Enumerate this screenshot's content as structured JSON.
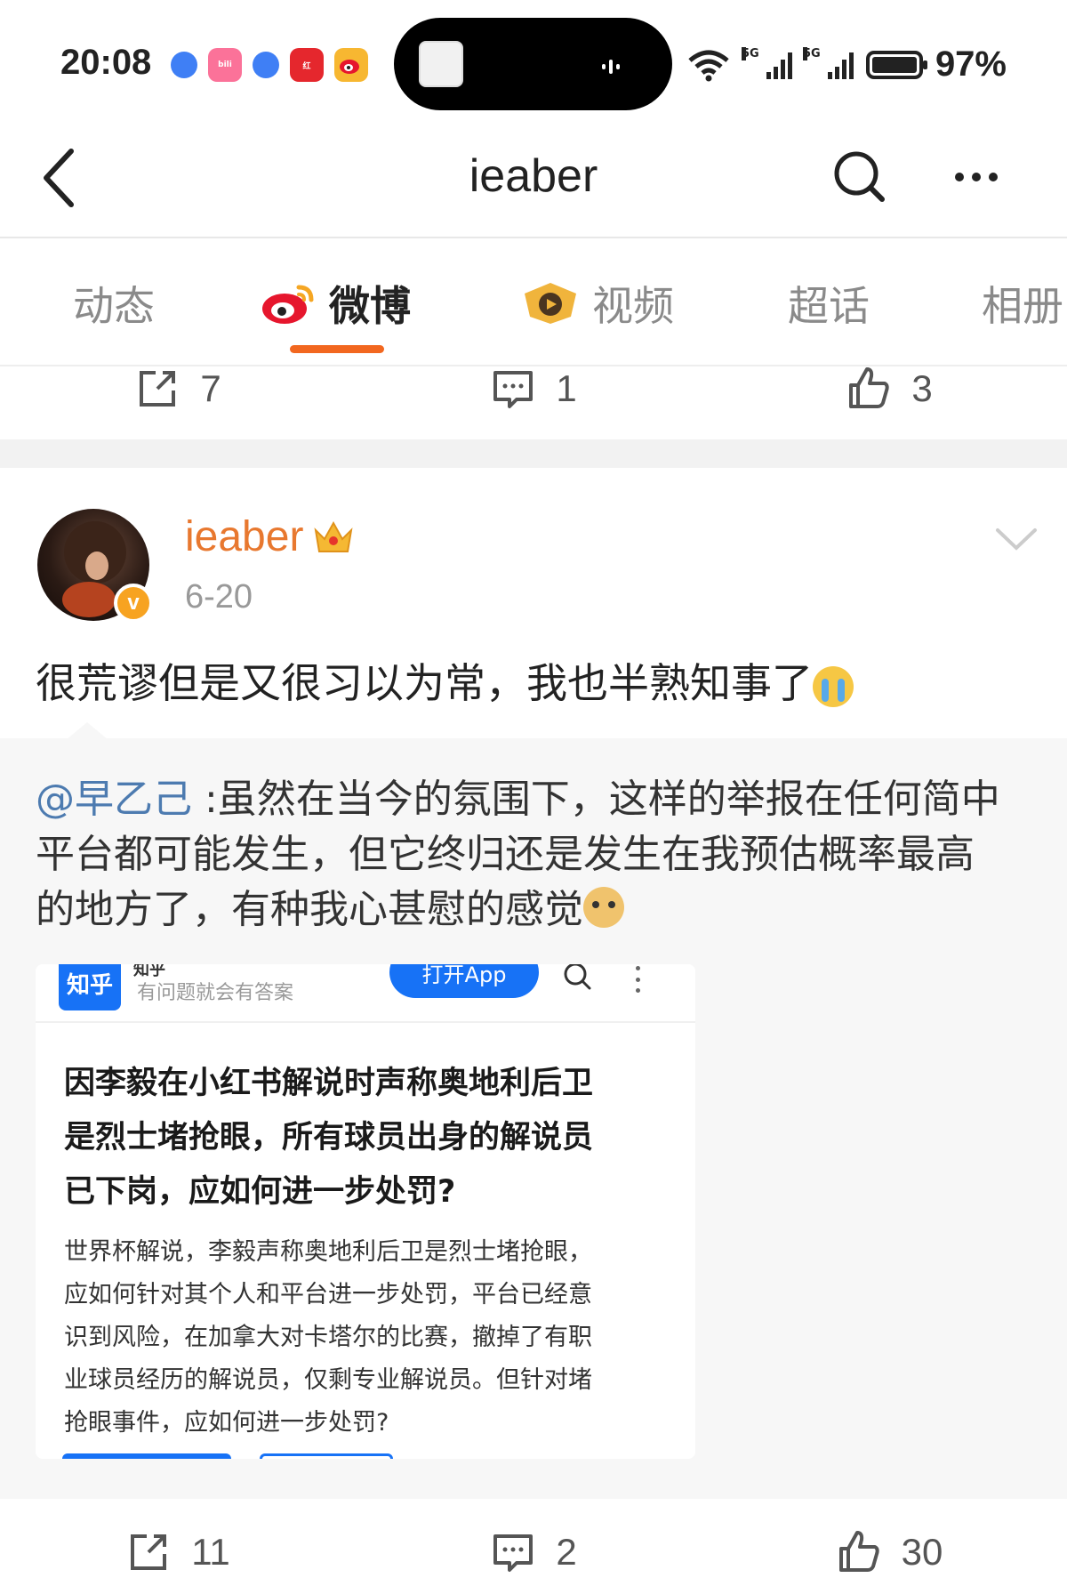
{
  "status_bar": {
    "time": "20:08",
    "battery": "97%",
    "signal_1": "5G",
    "signal_2": "5G",
    "wifi_tag": "6",
    "app_icons": [
      "compass-icon",
      "bilibili-icon",
      "compass-icon",
      "xiaohongshu-icon",
      "weibo-icon"
    ]
  },
  "navbar": {
    "title": "ieaber"
  },
  "tabs": [
    {
      "label": "动态"
    },
    {
      "label": "微博"
    },
    {
      "label": "视频"
    },
    {
      "label": "超话"
    },
    {
      "label": "相册"
    }
  ],
  "previous_post_actions": {
    "reposts": "7",
    "comments": "1",
    "likes": "3"
  },
  "post": {
    "username": "ieaber",
    "verified_badge": "v",
    "date": "6-20",
    "text": "很荒谬但是又很习以为常，我也半熟知事了",
    "repost": {
      "mention": "@早乙己",
      "text_line1": " :虽然在当今的氛围下，这样的举报在任何简中",
      "text_line2": "平台都可能发生，但它终归还是发生在我预估概率最高",
      "text_line3": "的地方了，有种我心甚慰的感觉"
    },
    "embedded_screenshot": {
      "logo": "知乎",
      "app_name": "知乎",
      "slogan": "有问题就会有答案",
      "open_app": "打开App",
      "question_title_1": "因李毅在小红书解说时声称奥地利后卫",
      "question_title_2": "是烈士堵抢眼，所有球员出身的解说员",
      "question_title_3": "已下岗，应如何进一步处罚?",
      "question_body_1": "世界杯解说，李毅声称奥地利后卫是烈士堵抢眼，",
      "question_body_2": "应如何针对其个人和平台进一步处罚，平台已经意",
      "question_body_3": "识到风险，在加拿大对卡塔尔的比赛，撤掉了有职",
      "question_body_4": "业球员经历的解说员，仅剩专业解说员。但针对堵",
      "question_body_5": "抢眼事件，应如何进一步处罚?"
    },
    "actions": {
      "reposts": "11",
      "comments": "2",
      "likes": "30"
    }
  },
  "colors": {
    "accent_orange": "#f2671f",
    "username_orange": "#e8782f",
    "mention_blue": "#4d7bb0",
    "zhihu_blue": "#1772f6"
  }
}
